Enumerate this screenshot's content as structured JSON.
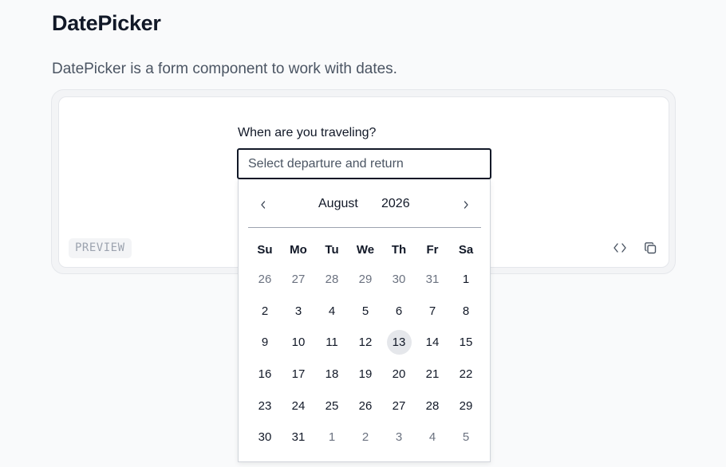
{
  "page": {
    "title": "DatePicker",
    "description": "DatePicker is a form component to work with dates."
  },
  "preview": {
    "badge": "PREVIEW",
    "code_icon": "code-icon",
    "copy_icon": "copy-icon"
  },
  "field": {
    "label": "When are you traveling?",
    "placeholder": "Select departure and return",
    "value": ""
  },
  "calendar": {
    "month": "August",
    "year": "2026",
    "prev_icon": "chevron-left-icon",
    "next_icon": "chevron-right-icon",
    "weekdays": [
      "Su",
      "Mo",
      "Tu",
      "We",
      "Th",
      "Fr",
      "Sa"
    ],
    "weeks": [
      [
        {
          "d": "26",
          "out": true
        },
        {
          "d": "27",
          "out": true
        },
        {
          "d": "28",
          "out": true
        },
        {
          "d": "29",
          "out": true
        },
        {
          "d": "30",
          "out": true
        },
        {
          "d": "31",
          "out": true
        },
        {
          "d": "1",
          "out": false
        }
      ],
      [
        {
          "d": "2",
          "out": false
        },
        {
          "d": "3",
          "out": false
        },
        {
          "d": "4",
          "out": false
        },
        {
          "d": "5",
          "out": false
        },
        {
          "d": "6",
          "out": false
        },
        {
          "d": "7",
          "out": false
        },
        {
          "d": "8",
          "out": false
        }
      ],
      [
        {
          "d": "9",
          "out": false
        },
        {
          "d": "10",
          "out": false
        },
        {
          "d": "11",
          "out": false
        },
        {
          "d": "12",
          "out": false
        },
        {
          "d": "13",
          "out": false,
          "today": true
        },
        {
          "d": "14",
          "out": false
        },
        {
          "d": "15",
          "out": false
        }
      ],
      [
        {
          "d": "16",
          "out": false
        },
        {
          "d": "17",
          "out": false
        },
        {
          "d": "18",
          "out": false
        },
        {
          "d": "19",
          "out": false
        },
        {
          "d": "20",
          "out": false
        },
        {
          "d": "21",
          "out": false
        },
        {
          "d": "22",
          "out": false
        }
      ],
      [
        {
          "d": "23",
          "out": false
        },
        {
          "d": "24",
          "out": false
        },
        {
          "d": "25",
          "out": false
        },
        {
          "d": "26",
          "out": false
        },
        {
          "d": "27",
          "out": false
        },
        {
          "d": "28",
          "out": false
        },
        {
          "d": "29",
          "out": false
        }
      ],
      [
        {
          "d": "30",
          "out": false
        },
        {
          "d": "31",
          "out": false
        },
        {
          "d": "1",
          "out": true
        },
        {
          "d": "2",
          "out": true
        },
        {
          "d": "3",
          "out": true
        },
        {
          "d": "4",
          "out": true
        },
        {
          "d": "5",
          "out": true
        }
      ]
    ]
  },
  "colors": {
    "text": "#111827",
    "muted": "#6b7280",
    "today_bg": "#e5e7eb",
    "border": "#111827"
  }
}
